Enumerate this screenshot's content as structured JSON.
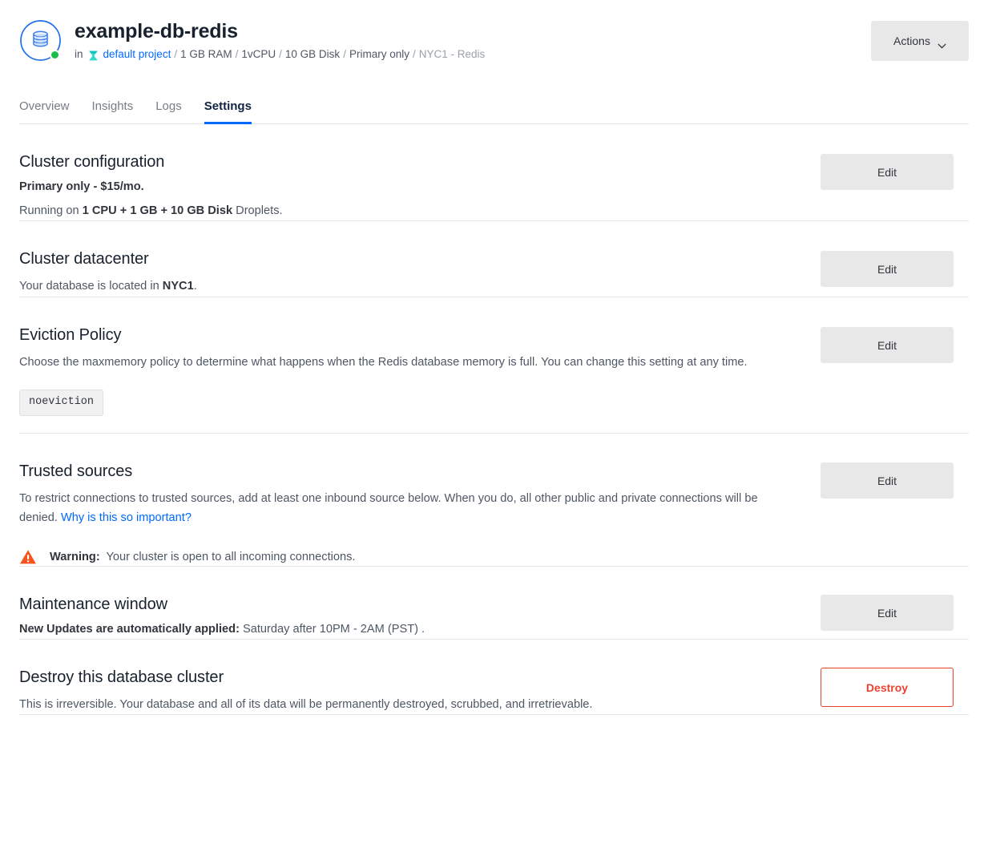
{
  "header": {
    "db_icon": "database-icon",
    "status": "online",
    "title": "example-db-redis",
    "meta": {
      "in_label": "in",
      "project_icon": "project-icon",
      "project_link": "default project",
      "items": [
        "1 GB RAM",
        "1vCPU",
        "10 GB Disk",
        "Primary only"
      ],
      "region_service": "NYC1 - Redis",
      "separator": "/"
    },
    "actions_label": "Actions",
    "actions_icon": "chevron-down-icon"
  },
  "tabs": [
    {
      "label": "Overview",
      "active": false
    },
    {
      "label": "Insights",
      "active": false
    },
    {
      "label": "Logs",
      "active": false
    },
    {
      "label": "Settings",
      "active": true
    }
  ],
  "sections": {
    "cluster_configuration": {
      "title": "Cluster configuration",
      "plan_line": "Primary only - $15/mo.",
      "running_prefix": "Running on ",
      "running_specs": "1 CPU + 1 GB + 10 GB Disk",
      "running_suffix": " Droplets.",
      "edit_label": "Edit"
    },
    "cluster_datacenter": {
      "title": "Cluster datacenter",
      "text_prefix": "Your database is located in ",
      "region": "NYC1",
      "text_suffix": ".",
      "edit_label": "Edit"
    },
    "eviction_policy": {
      "title": "Eviction Policy",
      "description": "Choose the maxmemory policy to determine what happens when the Redis database memory is full. You can change this setting at any time.",
      "policy_value": "noeviction",
      "edit_label": "Edit"
    },
    "trusted_sources": {
      "title": "Trusted sources",
      "description": "To restrict connections to trusted sources, add at least one inbound source below. When you do, all other public and private connections will be denied. ",
      "link_label": "Why is this so important?",
      "warning_icon": "warning-triangle-icon",
      "warning_label": "Warning:",
      "warning_text": " Your cluster is open to all incoming connections.",
      "edit_label": "Edit"
    },
    "maintenance_window": {
      "title": "Maintenance window",
      "label": "New Updates are automatically applied:",
      "value": " Saturday after 10PM - 2AM (PST) .",
      "edit_label": "Edit"
    },
    "destroy": {
      "title": "Destroy this database cluster",
      "description": "This is irreversible. Your database and all of its data will be permanently destroyed, scrubbed, and irretrievable.",
      "destroy_label": "Destroy"
    }
  },
  "colors": {
    "accent_blue": "#0069ff",
    "status_green": "#18bf4b",
    "danger_red": "#e8432f",
    "warning_orange": "#f5551f",
    "project_teal": "#2fd9d0",
    "button_gray": "#e8e8e8",
    "divider": "#e8e8e8"
  }
}
